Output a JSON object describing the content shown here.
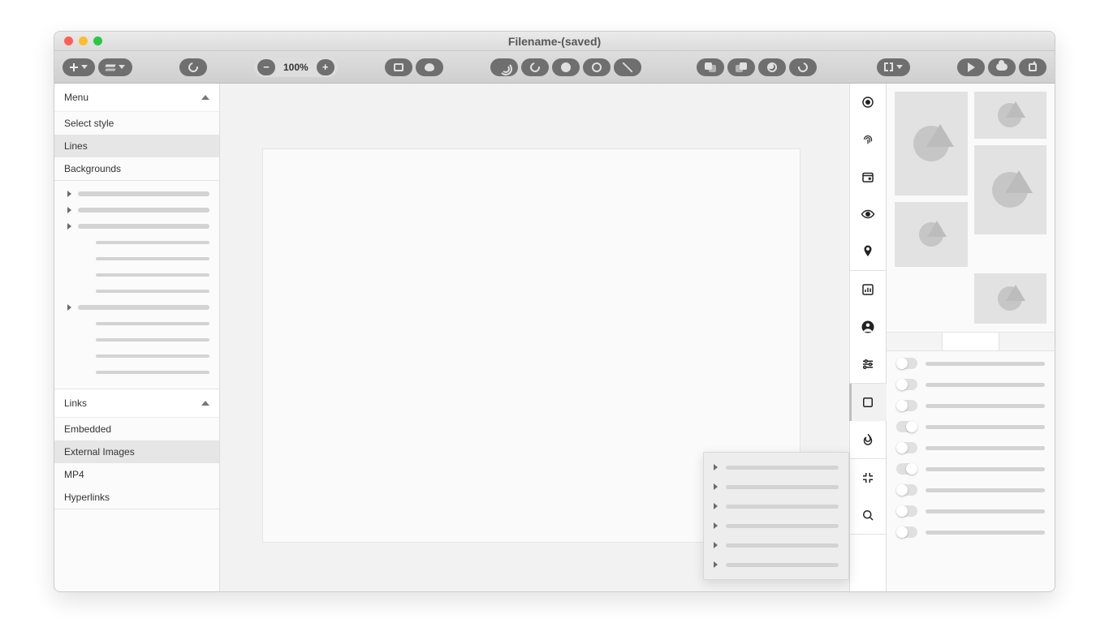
{
  "window": {
    "title": "Filename-(saved)"
  },
  "toolbar": {
    "zoom": "100%"
  },
  "left": {
    "menu": {
      "title": "Menu",
      "items": [
        "Select style",
        "Lines",
        "Backgrounds"
      ],
      "selected": 1
    },
    "links": {
      "title": "Links",
      "items": [
        "Embedded",
        "External Images",
        "MP4",
        "Hyperlinks"
      ],
      "selected": 1
    }
  },
  "rail_icons": [
    "target-icon",
    "fingerprint-icon",
    "calendar-icon",
    "eye-icon",
    "pin-icon",
    "chart-icon",
    "account-icon",
    "tune-icon",
    "checkbox-icon",
    "fire-icon",
    "collapse-icon",
    "search-icon"
  ],
  "inspector": {
    "tabs_active": 1,
    "toggle_count": 9
  }
}
